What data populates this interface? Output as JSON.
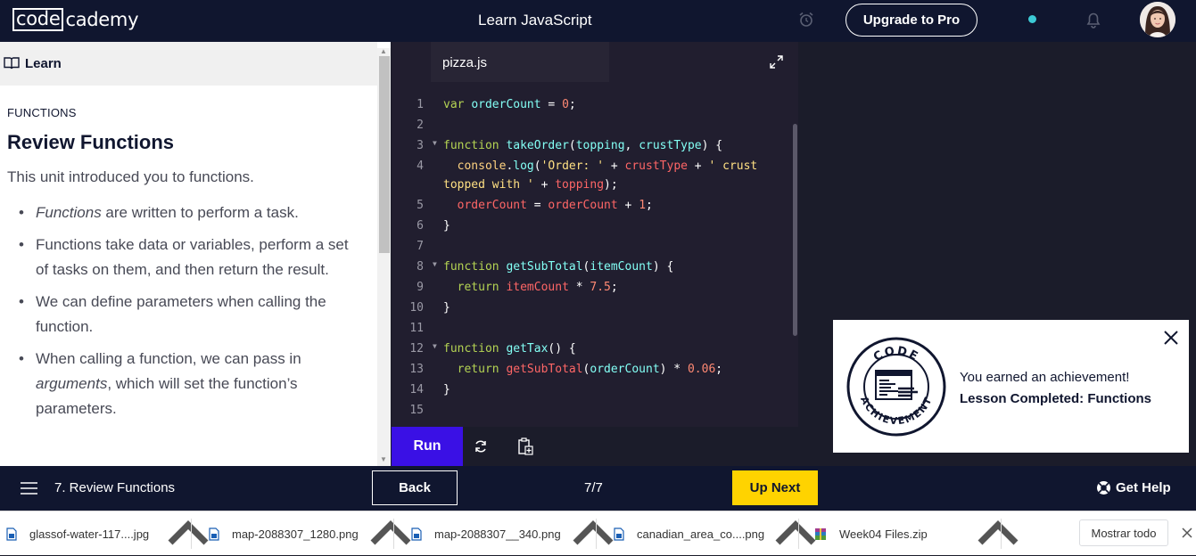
{
  "topbar": {
    "logo_box": "code",
    "logo_rest": "cademy",
    "course_title": "Learn JavaScript",
    "upgrade_label": "Upgrade to Pro"
  },
  "learn_panel": {
    "header": "Learn",
    "kicker": "FUNCTIONS",
    "title": "Review Functions",
    "intro": "This unit introduced you to functions.",
    "bullets": [
      {
        "em": "Functions",
        "rest": " are written to perform a task."
      },
      {
        "em": "",
        "rest": "Functions take data or variables, perform a set of tasks on them, and then return the result."
      },
      {
        "em": "",
        "rest": "We can define parameters when calling the function."
      },
      {
        "pre": "When calling a function, we can pass in ",
        "em": "arguments",
        "rest": ", which will set the function’s parameters."
      }
    ]
  },
  "editor": {
    "file_tab": "pizza.js",
    "run_label": "Run",
    "line_numbers": [
      "1",
      "2",
      "3",
      "4",
      "",
      "5",
      "6",
      "7",
      "8",
      "9",
      "10",
      "11",
      "12",
      "13",
      "14",
      "15"
    ]
  },
  "toast": {
    "line1": "You earned an achievement!",
    "line2": "Lesson Completed: Functions",
    "badge_top": "CODE",
    "badge_bottom": "ACHIEVEMENT"
  },
  "bottom_nav": {
    "lesson": "7. Review Functions",
    "back_label": "Back",
    "progress": "7/7",
    "next_label": "Up Next",
    "help_label": "Get Help"
  },
  "downloads": {
    "items": [
      {
        "name": "glassof-water-117....jpg",
        "icon": "image-file-icon"
      },
      {
        "name": "map-2088307_1280.png",
        "icon": "image-file-icon"
      },
      {
        "name": "map-2088307__340.png",
        "icon": "image-file-icon"
      },
      {
        "name": "canadian_area_co....png",
        "icon": "image-file-icon"
      },
      {
        "name": "Week04 Files.zip",
        "icon": "zip-archive-icon"
      }
    ],
    "show_all_label": "Mostrar todo"
  },
  "colors": {
    "nav_bg": "#10162f",
    "run_button": "#3a10e5",
    "next_button": "#ffd300",
    "editor_bg": "#211e2f",
    "status_dot": "#3ccad5"
  }
}
